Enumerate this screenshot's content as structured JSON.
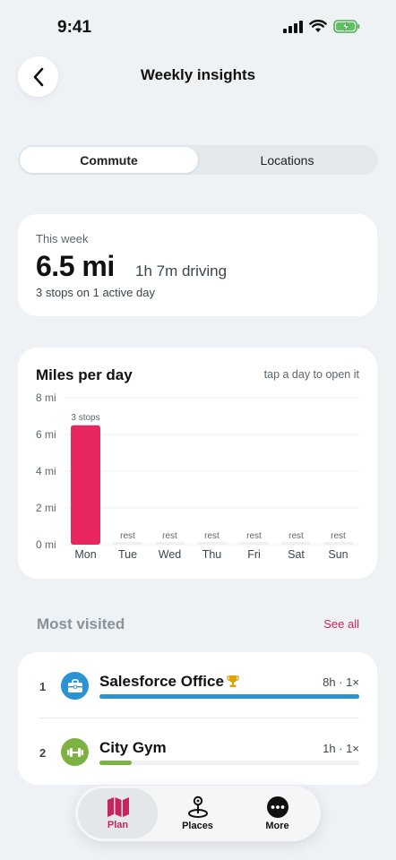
{
  "status_bar": {
    "time": "9:41"
  },
  "header": {
    "title": "Weekly insights"
  },
  "tabs": [
    {
      "label": "Commute",
      "active": true
    },
    {
      "label": "Locations",
      "active": false
    }
  ],
  "summary": {
    "label": "This week",
    "miles": "6.5 mi",
    "driving": "1h 7m driving",
    "stops": "3 stops on 1 active day"
  },
  "chart": {
    "title": "Miles per day",
    "hint": "tap a day to open it",
    "accent_color": "#e8275f"
  },
  "chart_data": {
    "type": "bar",
    "categories": [
      "Mon",
      "Tue",
      "Wed",
      "Thu",
      "Fri",
      "Sat",
      "Sun"
    ],
    "values": [
      6.5,
      0,
      0,
      0,
      0,
      0,
      0
    ],
    "bar_labels": [
      "3 stops",
      "rest",
      "rest",
      "rest",
      "rest",
      "rest",
      "rest"
    ],
    "ylim": [
      0,
      8
    ],
    "yticks": [
      0,
      2,
      4,
      6,
      8
    ],
    "ytick_labels": [
      "0 mi",
      "2 mi",
      "4 mi",
      "6 mi",
      "8 mi"
    ],
    "grid": true
  },
  "most_visited": {
    "title": "Most visited",
    "see_all": "See all",
    "places": [
      {
        "rank": "1",
        "name": "Salesforce Office",
        "meta": "8h · 1×",
        "icon": "briefcase-icon",
        "color": "#2b93d1",
        "share": 1.0,
        "trophy": true
      },
      {
        "rank": "2",
        "name": "City Gym",
        "meta": "1h · 1×",
        "icon": "dumbbell-icon",
        "color": "#7cb342",
        "share": 0.125,
        "trophy": false
      }
    ]
  },
  "nav": [
    {
      "label": "Plan",
      "icon": "map-icon",
      "active": true
    },
    {
      "label": "Places",
      "icon": "pin-icon",
      "active": false
    },
    {
      "label": "More",
      "icon": "more-icon",
      "active": false
    }
  ]
}
